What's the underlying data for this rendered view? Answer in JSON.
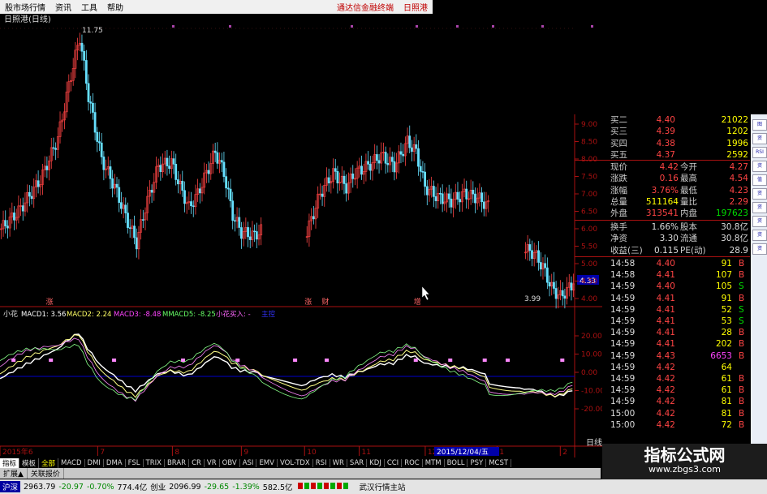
{
  "menu": {
    "items": [
      "股市场行情",
      "资讯",
      "工具",
      "帮助"
    ],
    "right_items": [
      "通达信金融终端",
      "日照港"
    ]
  },
  "window": {
    "title": "日照港(日线)"
  },
  "price_chart": {
    "high_label": "11.75",
    "low_label": "3.99",
    "current_price_tag": "4.33",
    "axis_ticks": [
      "9.00",
      "8.50",
      "8.00",
      "7.50",
      "7.00",
      "6.50",
      "6.00",
      "5.50",
      "5.00",
      "4.50",
      "4.00"
    ],
    "event_marks": [
      {
        "x": 0.08,
        "text": "涨"
      },
      {
        "x": 0.53,
        "text": "涨"
      },
      {
        "x": 0.56,
        "text": "财"
      },
      {
        "x": 0.72,
        "text": "增"
      }
    ]
  },
  "indicator": {
    "name": "小花",
    "legend": [
      {
        "text": "MACD1: 3.56",
        "color": "#ffffff"
      },
      {
        "text": "MACD2: 2.24",
        "color": "#ffff66"
      },
      {
        "text": "MACD3: -8.48",
        "color": "#ff44ff"
      },
      {
        "text": "MMACD5: -8.25",
        "color": "#66ff66"
      },
      {
        "text": "小花买入: -",
        "color": "#ff66ff"
      },
      {
        "text": "主控",
        "color": "#3333ff"
      }
    ],
    "axis_ticks": [
      "20.00",
      "10.00",
      "0.00",
      "-10.00",
      "-20.00"
    ]
  },
  "time_axis": {
    "labels": [
      {
        "x": 0.0,
        "text": "2015年6"
      },
      {
        "x": 0.17,
        "text": "7"
      },
      {
        "x": 0.3,
        "text": "8"
      },
      {
        "x": 0.42,
        "text": "9"
      },
      {
        "x": 0.53,
        "text": "10"
      },
      {
        "x": 0.625,
        "text": "11"
      },
      {
        "x": 0.74,
        "text": "12"
      },
      {
        "x": 0.865,
        "text": "1"
      },
      {
        "x": 0.975,
        "text": "2"
      }
    ],
    "cursor_date": "2015/12/04/五"
  },
  "quote_panel": {
    "order_book": [
      {
        "label": "买二",
        "price": "4.40",
        "vol": "21022"
      },
      {
        "label": "买三",
        "price": "4.39",
        "vol": "1202"
      },
      {
        "label": "买四",
        "price": "4.38",
        "vol": "1996"
      },
      {
        "label": "买五",
        "price": "4.37",
        "vol": "2592"
      }
    ],
    "stats": [
      {
        "l1": "现价",
        "v1": "4.42",
        "l2": "今开",
        "v2": "4.27",
        "c1": "#ff4444",
        "c2": "#ff4444"
      },
      {
        "l1": "涨跌",
        "v1": "0.16",
        "l2": "最高",
        "v2": "4.54",
        "c1": "#ff4444",
        "c2": "#ff4444"
      },
      {
        "l1": "涨幅",
        "v1": "3.76%",
        "l2": "最低",
        "v2": "4.23",
        "c1": "#ff4444",
        "c2": "#ff4444"
      },
      {
        "l1": "总量",
        "v1": "511164",
        "l2": "量比",
        "v2": "2.29",
        "c1": "#ffff00",
        "c2": "#ff4444"
      },
      {
        "l1": "外盘",
        "v1": "313541",
        "l2": "内盘",
        "v2": "197623",
        "c1": "#ff4444",
        "c2": "#00dd00"
      }
    ],
    "info": [
      {
        "l1": "换手",
        "v1": "1.66%",
        "l2": "股本",
        "v2": "30.8亿"
      },
      {
        "l1": "净资",
        "v1": "3.30",
        "l2": "流通",
        "v2": "30.8亿"
      },
      {
        "l1": "收益(三)",
        "v1": "0.115",
        "l2": "PE(动)",
        "v2": "28.9"
      }
    ],
    "ticks": [
      {
        "time": "14:58",
        "price": "4.40",
        "vol": "91",
        "side": "B"
      },
      {
        "time": "14:58",
        "price": "4.41",
        "vol": "107",
        "side": "B"
      },
      {
        "time": "14:59",
        "price": "4.40",
        "vol": "105",
        "side": "S"
      },
      {
        "time": "14:59",
        "price": "4.41",
        "vol": "91",
        "side": "B"
      },
      {
        "time": "14:59",
        "price": "4.41",
        "vol": "52",
        "side": "S"
      },
      {
        "time": "14:59",
        "price": "4.41",
        "vol": "53",
        "side": "S"
      },
      {
        "time": "14:59",
        "price": "4.41",
        "vol": "28",
        "side": "B"
      },
      {
        "time": "14:59",
        "price": "4.41",
        "vol": "202",
        "side": "B"
      },
      {
        "time": "14:59",
        "price": "4.43",
        "vol": "6653",
        "side": "B"
      },
      {
        "time": "14:59",
        "price": "4.42",
        "vol": "64",
        "side": ""
      },
      {
        "time": "14:59",
        "price": "4.42",
        "vol": "61",
        "side": "B"
      },
      {
        "time": "14:59",
        "price": "4.42",
        "vol": "61",
        "side": "B"
      },
      {
        "time": "14:59",
        "price": "4.42",
        "vol": "81",
        "side": "B"
      },
      {
        "time": "15:00",
        "price": "4.42",
        "vol": "81",
        "side": "B"
      },
      {
        "time": "15:00",
        "price": "4.42",
        "vol": "72",
        "side": "B"
      }
    ],
    "period_label": "日线"
  },
  "right_toolbar": [
    "图",
    "资",
    "RSI",
    "资",
    "值",
    "资",
    "资",
    "资",
    "资",
    "资"
  ],
  "indicator_tabs": [
    "指标",
    "模板",
    "全部",
    "MACD",
    "DMI",
    "DMA",
    "FSL",
    "TRIX",
    "BRAR",
    "CR",
    "VR",
    "OBV",
    "ASI",
    "EMV",
    "VOL-TDX",
    "RSI",
    "WR",
    "SAR",
    "KDJ",
    "CCI",
    "ROC",
    "MTM",
    "BOLL",
    "PSY",
    "MCST"
  ],
  "sub_tabs": [
    "扩展▲",
    "关联报价"
  ],
  "status": {
    "sh_name": "沪深",
    "sh_index": "2963.79",
    "sh_chg": "-20.97",
    "sh_pct": "-0.70%",
    "sh_amt": "774.4亿",
    "cy_name": "创业",
    "cy_index": "2096.99",
    "cy_chg": "-29.65",
    "cy_pct": "-1.39%",
    "cy_amt": "582.5亿",
    "station": "武汉行情主站"
  },
  "watermark": {
    "title": "指标公式网",
    "url": "www.zbgs3.com"
  },
  "colors": {
    "up": "#ff4444",
    "down": "#66e0ff",
    "axis": "#aa1111",
    "text": "#dddddd"
  }
}
